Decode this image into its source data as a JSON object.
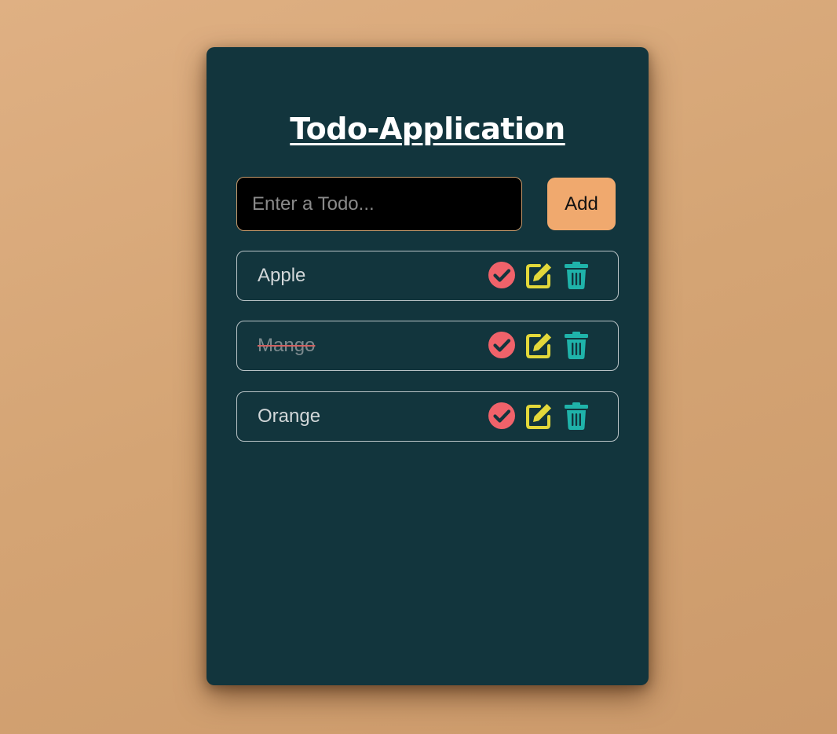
{
  "app": {
    "title": "Todo-Application"
  },
  "form": {
    "input_placeholder": "Enter a Todo...",
    "input_value": "",
    "add_label": "Add"
  },
  "todos": [
    {
      "text": "Apple",
      "completed": false
    },
    {
      "text": "Mango",
      "completed": true
    },
    {
      "text": "Orange",
      "completed": false
    }
  ],
  "icons": {
    "complete": "check-circle-icon",
    "edit": "edit-icon",
    "delete": "trash-icon"
  },
  "colors": {
    "card_background": "#12353d",
    "accent_button": "#f0a96e",
    "check_icon": "#f0626a",
    "edit_icon": "#e3d83a",
    "delete_icon": "#1fb3aa"
  }
}
